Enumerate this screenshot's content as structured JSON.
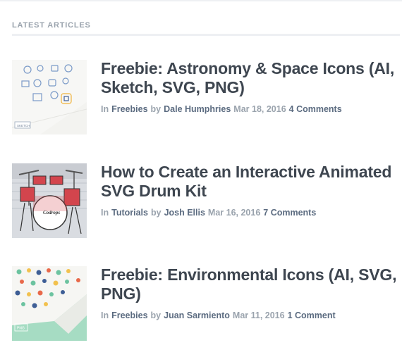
{
  "section": {
    "title": "Latest Articles"
  },
  "meta_words": {
    "in": "In",
    "by": "by"
  },
  "articles": [
    {
      "title": "Freebie: Astronomy & Space Icons (AI, Sketch, SVG, PNG)",
      "category": "Freebies",
      "author": "Dale Humphries",
      "date": "Mar 18, 2016",
      "comments": "4 Comments",
      "thumb_label": "SKETCH"
    },
    {
      "title": "How to Create an Interactive Animated SVG Drum Kit",
      "category": "Tutorials",
      "author": "Josh Ellis",
      "date": "Mar 16, 2016",
      "comments": "7 Comments",
      "thumb_label": "Codrops"
    },
    {
      "title": "Freebie: Environmental Icons (AI, SVG, PNG)",
      "category": "Freebies",
      "author": "Juan Sarmiento",
      "date": "Mar 11, 2016",
      "comments": "1 Comment",
      "thumb_label": "PNG"
    }
  ],
  "colors": {
    "title": "#3e4650",
    "meta_muted": "#9aa3ad",
    "meta_link": "#5b6b80",
    "rule": "#eef0f3"
  }
}
